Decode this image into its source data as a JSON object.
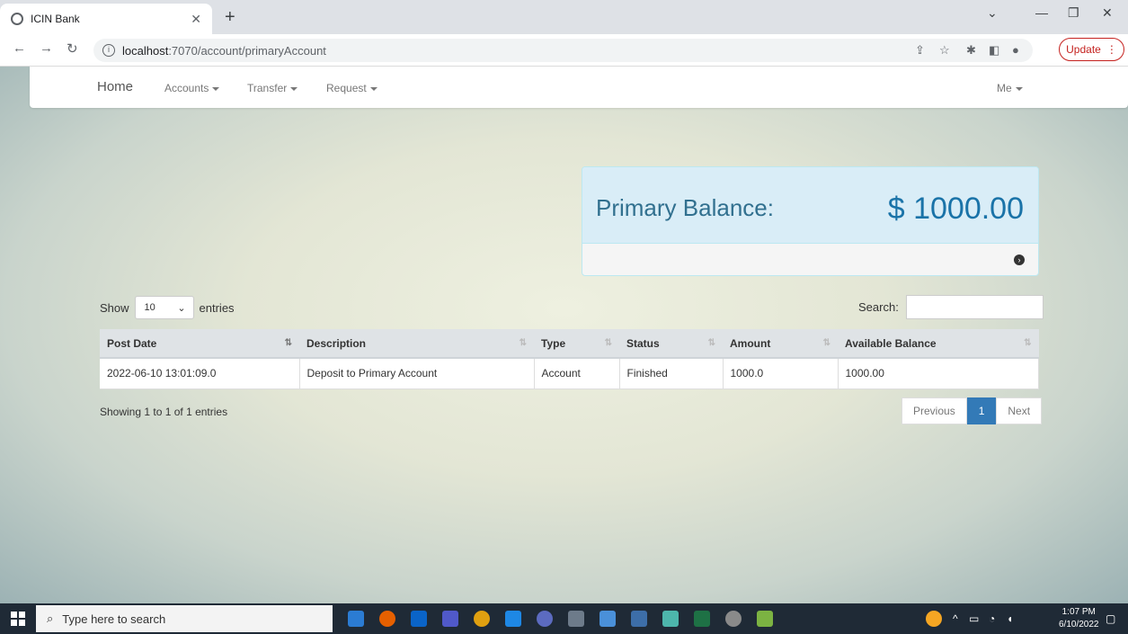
{
  "browser": {
    "tab_title": "ICIN Bank",
    "url_host": "localhost",
    "url_path": ":7070/account/primaryAccount",
    "update_label": "Update"
  },
  "navbar": {
    "home": "Home",
    "accounts": "Accounts",
    "transfer": "Transfer",
    "request": "Request",
    "me": "Me"
  },
  "balance": {
    "label": "Primary Balance:",
    "value": "$ 1000.00"
  },
  "table_controls": {
    "show_label": "Show",
    "page_size": "10",
    "entries_label": "entries",
    "search_label": "Search:"
  },
  "table": {
    "columns": [
      "Post Date",
      "Description",
      "Type",
      "Status",
      "Amount",
      "Available Balance"
    ],
    "rows": [
      [
        "2022-06-10 13:01:09.0",
        "Deposit to Primary Account",
        "Account",
        "Finished",
        "1000.0",
        "1000.00"
      ]
    ]
  },
  "pagination": {
    "info": "Showing 1 to 1 of 1 entries",
    "previous": "Previous",
    "current": "1",
    "next": "Next"
  },
  "taskbar": {
    "search_placeholder": "Type here to search",
    "time": "1:07 PM",
    "date": "6/10/2022"
  }
}
